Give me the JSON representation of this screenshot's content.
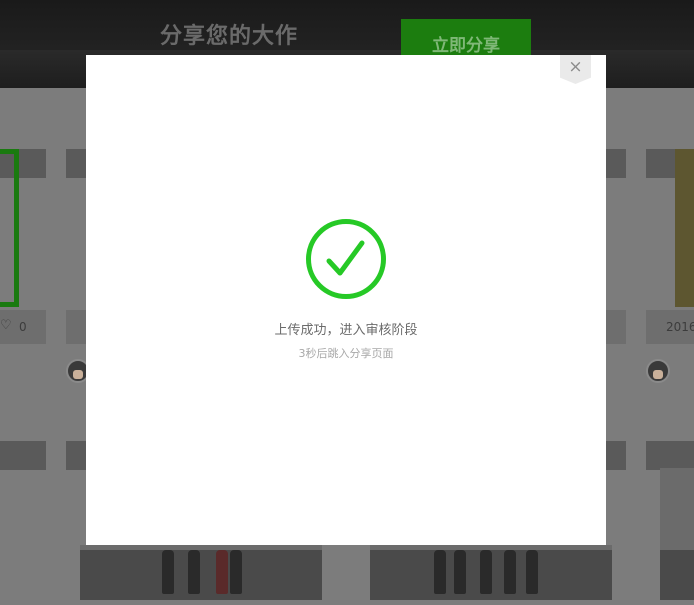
{
  "background": {
    "banner_title": "分享您的大作",
    "share_button_label": "立即分享",
    "like_count": "0",
    "date_fragment": "2016"
  },
  "modal": {
    "close_label": "×",
    "success_message": "上传成功，进入审核阶段",
    "redirect_message": "3秒后跳入分享页面"
  },
  "colors": {
    "success_green": "#26c926",
    "modal_bg": "#ffffff"
  },
  "icons": {
    "success": "check-circle-icon",
    "close": "close-icon",
    "like": "heart-icon"
  }
}
